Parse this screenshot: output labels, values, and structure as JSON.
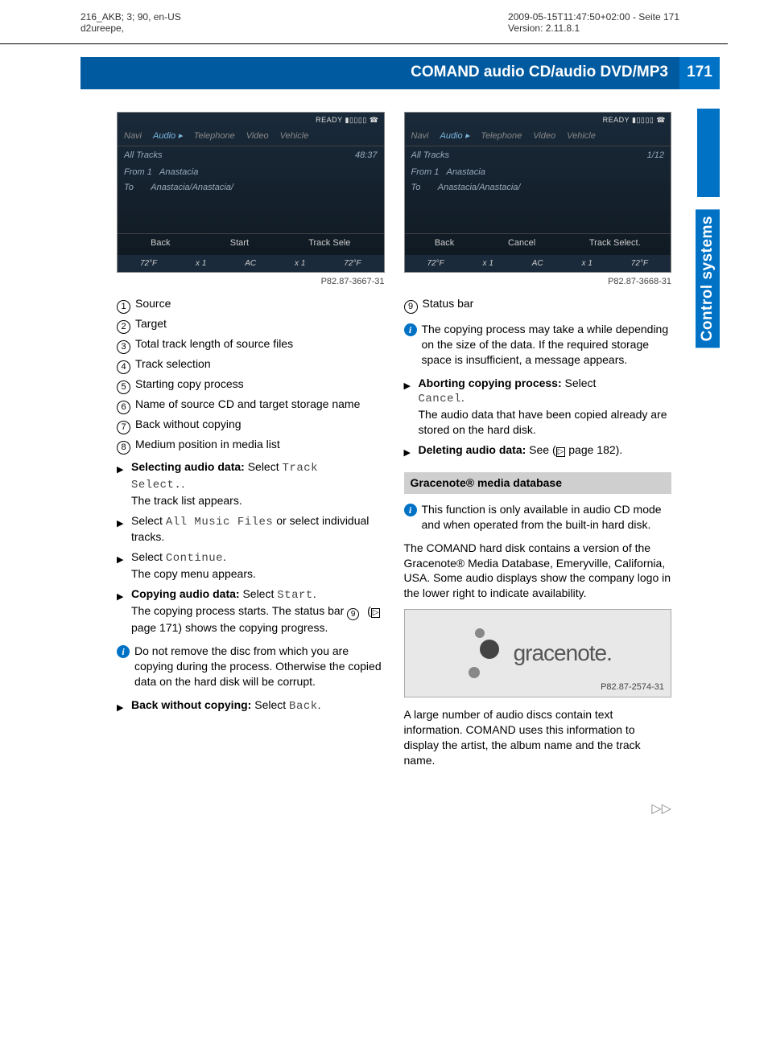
{
  "header": {
    "leftLine1": "216_AKB; 3; 90, en-US",
    "leftLine2": "d2ureepe,",
    "rightLine1": "2009-05-15T11:47:50+02:00 - Seite 171",
    "rightLine2": "Version: 2.11.8.1"
  },
  "titleBar": {
    "label": "COMAND audio CD/audio DVD/MP3",
    "pageNum": "171"
  },
  "sideTab": "Control systems",
  "leftCol": {
    "screenshot": {
      "ready": "READY ▮▯▯▯▯ ☎",
      "menu": [
        "Navi",
        "Audio ▸",
        "Telephone",
        "Video",
        "Vehicle"
      ],
      "allTracks": "All Tracks",
      "time": "48:37",
      "fromLine": "From  1",
      "toLine": "To",
      "name1": "Anastacia",
      "name2": "Anastacia/Anastacia/",
      "btn_back": "Back",
      "btn_start": "Start",
      "btn_select": "Track Sele",
      "status": [
        "72°F",
        "x 1",
        "AC",
        "x 1",
        "72°F"
      ]
    },
    "figCap1": "P82.87-3667-31",
    "legend": [
      {
        "n": "1",
        "t": "Source"
      },
      {
        "n": "2",
        "t": "Target"
      },
      {
        "n": "3",
        "t": "Total track length of source files"
      },
      {
        "n": "4",
        "t": "Track selection"
      },
      {
        "n": "5",
        "t": "Starting copy process"
      },
      {
        "n": "6",
        "t": "Name of source CD and target storage name"
      },
      {
        "n": "7",
        "t": "Back without copying"
      },
      {
        "n": "8",
        "t": "Medium position in media list"
      }
    ],
    "b1_bold": "Selecting audio data:",
    "b1_sel": " Select ",
    "b1_mono": "Track ",
    "b1_mono2": "Select.",
    "b1_after": ".",
    "b1_line2": "The track list appears.",
    "b2_pre": "Select ",
    "b2_mono": "All Music Files",
    "b2_post": " or select individual tracks.",
    "b3_pre": "Select ",
    "b3_mono": "Continue",
    "b3_post": ".",
    "b3_line2": "The copy menu appears.",
    "b4_bold": "Copying audio data:",
    "b4_sel": " Select ",
    "b4_mono": "Start",
    "b4_post": ".",
    "b4_line2a": "The copying process starts. The status bar ",
    "b4_line2_ref": "9",
    "b4_line2b": " (",
    "b4_page": " page 171) shows the copying progress.",
    "info1": "Do not remove the disc from which you are copying during the process. Otherwise the copied data on the hard disk will be corrupt.",
    "b5_bold": "Back without copying:",
    "b5_sel": " Select ",
    "b5_mono": "Back",
    "b5_post": "."
  },
  "rightCol": {
    "screenshot": {
      "ready": "READY ▮▯▯▯▯ ☎",
      "menu": [
        "Navi",
        "Audio ▸",
        "Telephone",
        "Video",
        "Vehicle"
      ],
      "allTracks": "All Tracks",
      "count": "1/12",
      "fromLine": "From  1",
      "toLine": "To",
      "name1": "Anastacia",
      "name2": "Anastacia/Anastacia/",
      "btn_back": "Back",
      "btn_cancel": "Cancel",
      "btn_select": "Track Select.",
      "status": [
        "72°F",
        "x 1",
        "AC",
        "x 1",
        "72°F"
      ]
    },
    "figCap2": "P82.87-3668-31",
    "legend9_n": "9",
    "legend9_t": "Status bar",
    "info2": "The copying process may take a while depending on the size of the data. If the required storage space is insufficient, a message appears.",
    "b6_bold": "Aborting copying process:",
    "b6_sel": " Select ",
    "b6_mono": "Cancel",
    "b6_post": ".",
    "b6_line2": "The audio data that have been copied already are stored on the hard disk.",
    "b7_bold": "Deleting audio data:",
    "b7_txt": " See (",
    "b7_page": " page 182).",
    "section": "Gracenote® media database",
    "info3": "This function is only available in audio CD mode and when operated from the built-in hard disk.",
    "para1": "The COMAND hard disk contains a version of the Gracenote® Media Database, Emeryville, California, USA. Some audio displays show the company logo in the lower right to indicate availability.",
    "logoText": "gracenote.",
    "logoCap": "P82.87-2574-31",
    "para2": "A large number of audio discs contain text information. COMAND uses this information to display the artist, the album name and the track name."
  },
  "footerArrow": "▷▷"
}
